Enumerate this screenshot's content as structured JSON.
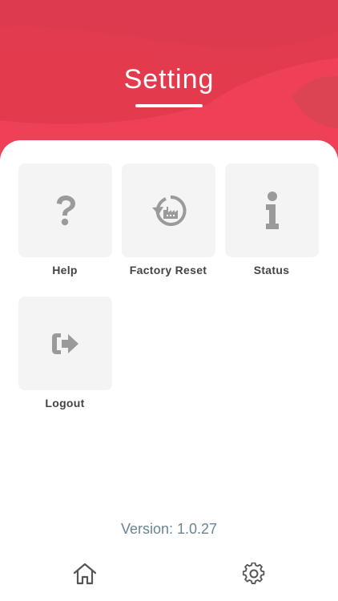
{
  "header": {
    "title": "Setting"
  },
  "grid": {
    "items": [
      {
        "label": "Help",
        "icon": "question-mark-icon"
      },
      {
        "label": "Factory Reset",
        "icon": "factory-reset-icon"
      },
      {
        "label": "Status",
        "icon": "info-icon"
      },
      {
        "label": "Logout",
        "icon": "logout-icon"
      }
    ]
  },
  "footer": {
    "version": "Version: 1.0.27"
  },
  "bottom_nav": {
    "items": [
      {
        "icon": "home-icon"
      },
      {
        "icon": "gear-icon"
      }
    ]
  },
  "colors": {
    "header_primary": "#e8384e",
    "tile_background": "#f4f4f4",
    "icon_gray": "#9a9a9a",
    "version_text": "#6a8494"
  }
}
